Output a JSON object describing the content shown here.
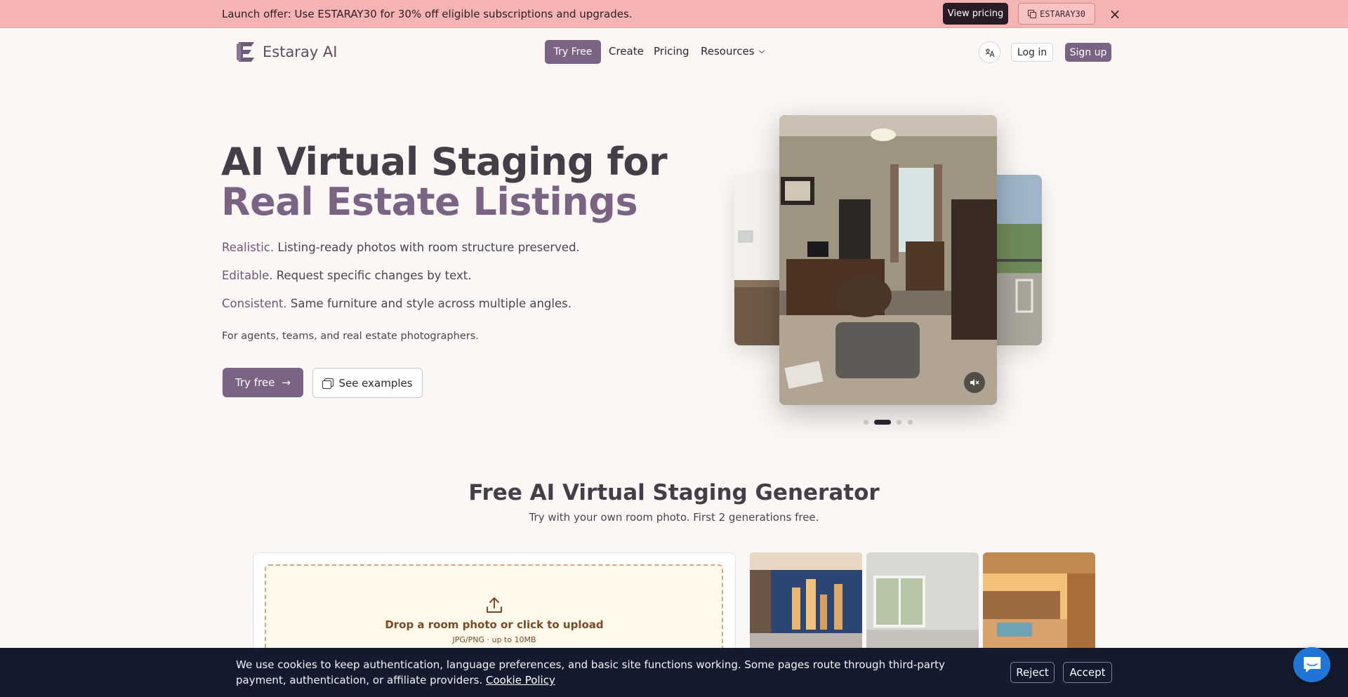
{
  "promo": {
    "text": "Launch offer: Use ESTARAY30 for 30% off eligible subscriptions and upgrades.",
    "cta": "View pricing",
    "code": "ESTARAY30",
    "close": "×"
  },
  "nav": {
    "brand": "Estaray AI",
    "try_free": "Try Free",
    "links": [
      "Create",
      "Pricing",
      "Resources"
    ],
    "language_icon": "translate-icon",
    "login": "Log in",
    "signup": "Sign up"
  },
  "hero": {
    "title_line1": "AI Virtual Staging for",
    "title_line2": "Real Estate Listings",
    "features": [
      {
        "label": "Realistic.",
        "text": " Listing-ready photos with room structure preserved."
      },
      {
        "label": "Editable.",
        "text": " Request specific changes by text."
      },
      {
        "label": "Consistent.",
        "text": " Same furniture and style across multiple angles."
      }
    ],
    "audience": "For agents, teams, and real estate photographers.",
    "cta_primary": "Try free",
    "cta_secondary": "See examples"
  },
  "carousel": {
    "active_index": 1,
    "slide_count": 4,
    "mute_icon": "speaker-muted-icon"
  },
  "generator": {
    "title": "Free AI Virtual Staging Generator",
    "subtitle": "Try with your own room photo. First 2 generations free.",
    "drop_title": "Drop a room photo or click to upload",
    "drop_hint": "JPG/PNG · up to 10MB"
  },
  "cookie": {
    "text": "We use cookies to keep authentication, language preferences, and basic site functions working. Some pages route through third-party payment, authentication, or affiliate providers.",
    "link": "Cookie Policy",
    "reject": "Reject",
    "accept": "Accept"
  },
  "colors": {
    "brand": "#7b6483",
    "promo_bg": "#f5b3b3",
    "cookie_bg": "#151b2e",
    "chat": "#1f76d6"
  }
}
